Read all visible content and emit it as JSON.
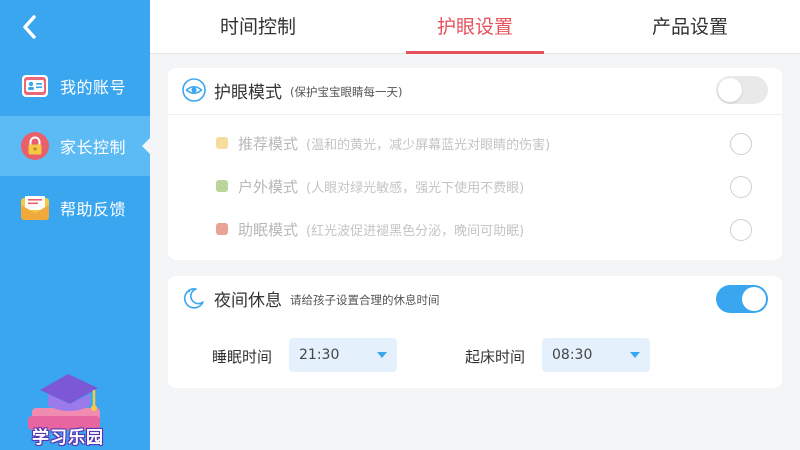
{
  "sidebar": {
    "back_icon": "chevron-left-icon",
    "items": [
      {
        "label": "我的账号",
        "icon": "account-card-icon"
      },
      {
        "label": "家长控制",
        "icon": "lock-icon"
      },
      {
        "label": "帮助反馈",
        "icon": "envelope-icon"
      }
    ],
    "active_index": 1,
    "logo_text": "学习乐园"
  },
  "tabs": [
    {
      "label": "时间控制"
    },
    {
      "label": "护眼设置"
    },
    {
      "label": "产品设置"
    }
  ],
  "active_tab": 1,
  "eye_care": {
    "title": "护眼模式",
    "subtitle": "(保护宝宝眼睛每一天)",
    "enabled": false,
    "modes": [
      {
        "name": "推荐模式",
        "desc": "(温和的黄光，减少屏幕蓝光对眼睛的伤害)",
        "color": "#f0c14b",
        "selected": false
      },
      {
        "name": "户外模式",
        "desc": "(人眼对绿光敏感，强光下使用不费眼)",
        "color": "#7fb24a",
        "selected": false
      },
      {
        "name": "助眠模式",
        "desc": "(红光波促进褪黑色分泌，晚间可助眠)",
        "color": "#d9553f",
        "selected": false
      }
    ]
  },
  "night_rest": {
    "title": "夜间休息",
    "subtitle": "请给孩子设置合理的休息时间",
    "enabled": true,
    "sleep_label": "睡眠时间",
    "sleep_value": "21:30",
    "wake_label": "起床时间",
    "wake_value": "08:30"
  },
  "colors": {
    "accent": "#3aa6ef",
    "tab_active": "#e6525c"
  }
}
